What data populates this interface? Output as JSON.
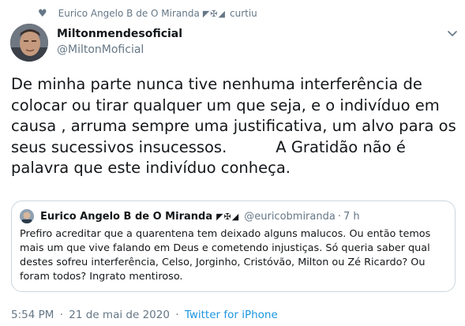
{
  "liked_banner": {
    "icon": "heart-icon",
    "user": "Eurico Angelo B de O Miranda",
    "flag_icon": "◤✠◢",
    "action": "curtiu"
  },
  "author": {
    "display_name": "Miltonmendesoficial",
    "handle": "@MiltonMoficial",
    "menu_icon": "chevron-down-icon"
  },
  "tweet": {
    "text": "De minha parte nunca tive nenhuma interferência de colocar ou tirar qualquer um que seja, e o indivíduo em causa , arruma sempre uma justificativa, um alvo para os seus sucessivos insucessos.          A Gratidão não é palavra que este indivíduo conheça."
  },
  "quoted_tweet": {
    "display_name": "Eurico Angelo B de O Miranda",
    "flag_icon": "◤✠◢",
    "handle": "@euricobmiranda",
    "separator": "·",
    "time": "7 h",
    "text": "Prefiro acreditar que a quarentena tem deixado alguns malucos. Ou então temos mais um que vive falando em Deus e cometendo injustiças. Só queria saber qual destes sofreu interferência, Celso, Jorginho, Cristóvão, Milton ou Zé Ricardo? Ou foram todos? Ingrato mentiroso."
  },
  "footer": {
    "time": "5:54 PM",
    "separator": "·",
    "date": "21 de mai de 2020",
    "source": "Twitter for iPhone"
  },
  "colors": {
    "text": "#14171a",
    "secondary": "#657786",
    "link": "#1b95e0",
    "border": "#ccd6dd"
  }
}
